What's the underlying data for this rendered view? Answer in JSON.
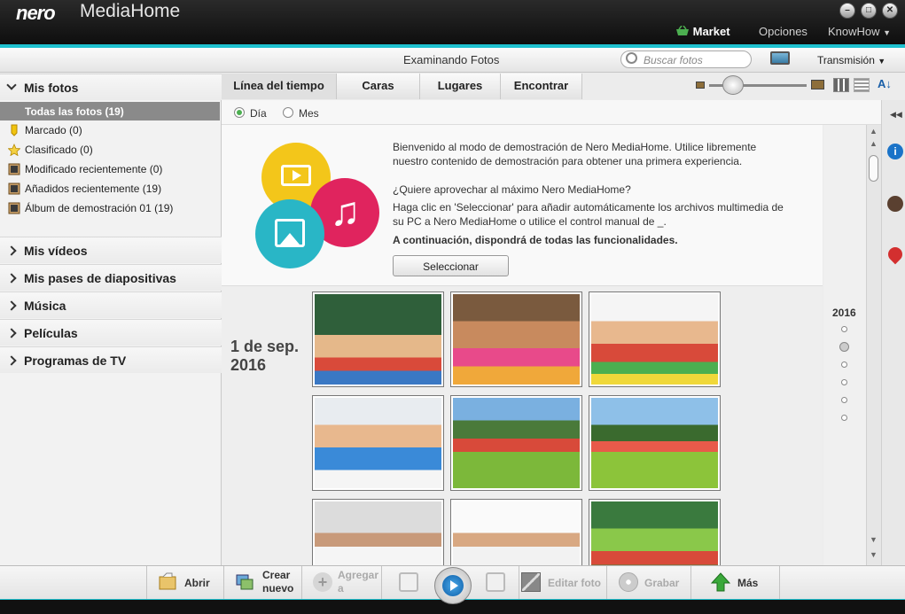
{
  "app": {
    "logo": "nero",
    "name": "MediaHome"
  },
  "window_controls": {
    "min": "–",
    "max": "□",
    "close": "✕"
  },
  "topnav": {
    "market": "Market",
    "options": "Opciones",
    "knowhow": "KnowHow"
  },
  "header": {
    "title": "Examinando Fotos",
    "search_placeholder": "Buscar fotos",
    "transmission": "Transmisión"
  },
  "sidebar": {
    "photos_label": "Mis fotos",
    "all_photos": "Todas las fotos (19)",
    "items": [
      {
        "label": "Marcado (0)",
        "icon": "tag-icon"
      },
      {
        "label": "Clasificado (0)",
        "icon": "star-icon"
      },
      {
        "label": "Modificado recientemente (0)",
        "icon": "photo-album-icon"
      },
      {
        "label": "Añadidos recientemente (19)",
        "icon": "photo-album-icon"
      },
      {
        "label": "Álbum de demostración 01 (19)",
        "icon": "photo-album-icon"
      }
    ],
    "sections": [
      {
        "label": "Mis vídeos"
      },
      {
        "label": "Mis pases de diapositivas"
      },
      {
        "label": "Música"
      },
      {
        "label": "Películas"
      },
      {
        "label": "Programas de TV"
      }
    ]
  },
  "tabs": [
    {
      "label": "Línea del tiempo",
      "active": true
    },
    {
      "label": "Caras"
    },
    {
      "label": "Lugares"
    },
    {
      "label": "Encontrar"
    }
  ],
  "view": {
    "day": "Día",
    "month": "Mes",
    "selected": "Día"
  },
  "demo": {
    "p1": "Bienvenido al modo de demostración de Nero MediaHome. Utilice libremente nuestro contenido de demostración para obtener una primera experiencia.",
    "p2": "¿Quiere aprovechar al máximo Nero MediaHome?",
    "p3": "Haga clic en 'Seleccionar' para añadir automáticamente los archivos multimedia de su PC a Nero MediaHome o utilice el control manual de _.",
    "p4": "A continuación, dispondrá de todas las funcionalidades.",
    "button": "Seleccionar"
  },
  "gallery": {
    "date_line1": "1 de sep.",
    "date_line2": "2016"
  },
  "timeline": {
    "year": "2016"
  },
  "bottom": {
    "open": "Abrir",
    "create_1": "Crear",
    "create_2": "nuevo",
    "add_1": "Agregar",
    "add_2": "a",
    "edit": "Editar foto",
    "burn": "Grabar",
    "more": "Más"
  },
  "colors": {
    "accent": "#1ec1cf",
    "market_green": "#4caf50",
    "play_blue": "#1a73c8"
  }
}
